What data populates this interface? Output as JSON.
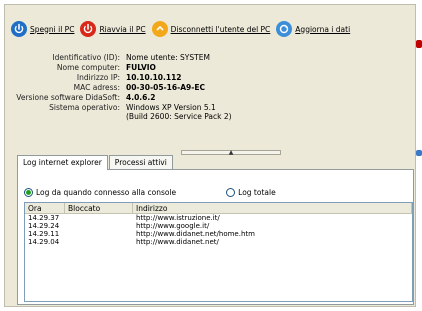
{
  "toolbar": {
    "shutdown_label": "Spegni il PC",
    "restart_label": "Riavvia il PC",
    "logoff_label": "Disconnetti l'utente del PC",
    "refresh_label": "Aggiorna i dati"
  },
  "info": {
    "rows": [
      {
        "key": "Identificativo (ID):",
        "value": "Nome utente:  SYSTEM"
      },
      {
        "key": "Nome computer:",
        "value": "FULVIO"
      },
      {
        "key": "Indirizzo IP:",
        "value": "10.10.10.112"
      },
      {
        "key": "MAC adress:",
        "value": "00-30-05-16-A9-EC"
      },
      {
        "key": "Versione software DidaSoft:",
        "value": "4.0.6.2"
      },
      {
        "key": "Sistema operativo:",
        "value_line1": "Windows XP Version 5.1",
        "value_line2": "(Build 2600: Service Pack 2)"
      }
    ]
  },
  "tabs": [
    {
      "label": "Log internet explorer"
    },
    {
      "label": "Processi attivi"
    }
  ],
  "radios": {
    "option1": "Log da quando connesso alla console",
    "option2": "Log totale",
    "selected": "option1"
  },
  "log": {
    "columns": [
      "Ora",
      "Bloccato",
      "Indirizzo"
    ],
    "rows": [
      {
        "time": "14.29.37",
        "blocked": "",
        "address": "http://www.istruzione.it/"
      },
      {
        "time": "14.29.24",
        "blocked": "",
        "address": "http://www.google.it/"
      },
      {
        "time": "14.29.11",
        "blocked": "",
        "address": "http://www.didanet.net/home.htm"
      },
      {
        "time": "14.29.04",
        "blocked": "",
        "address": "http://www.didanet.net/"
      }
    ]
  },
  "colors": {
    "window_bg": "#ece9d8",
    "shutdown_icon": "#1f6fc7",
    "restart_icon": "#d8281a",
    "logoff_icon": "#f2a81a",
    "refresh_icon": "#3d8ed8"
  }
}
